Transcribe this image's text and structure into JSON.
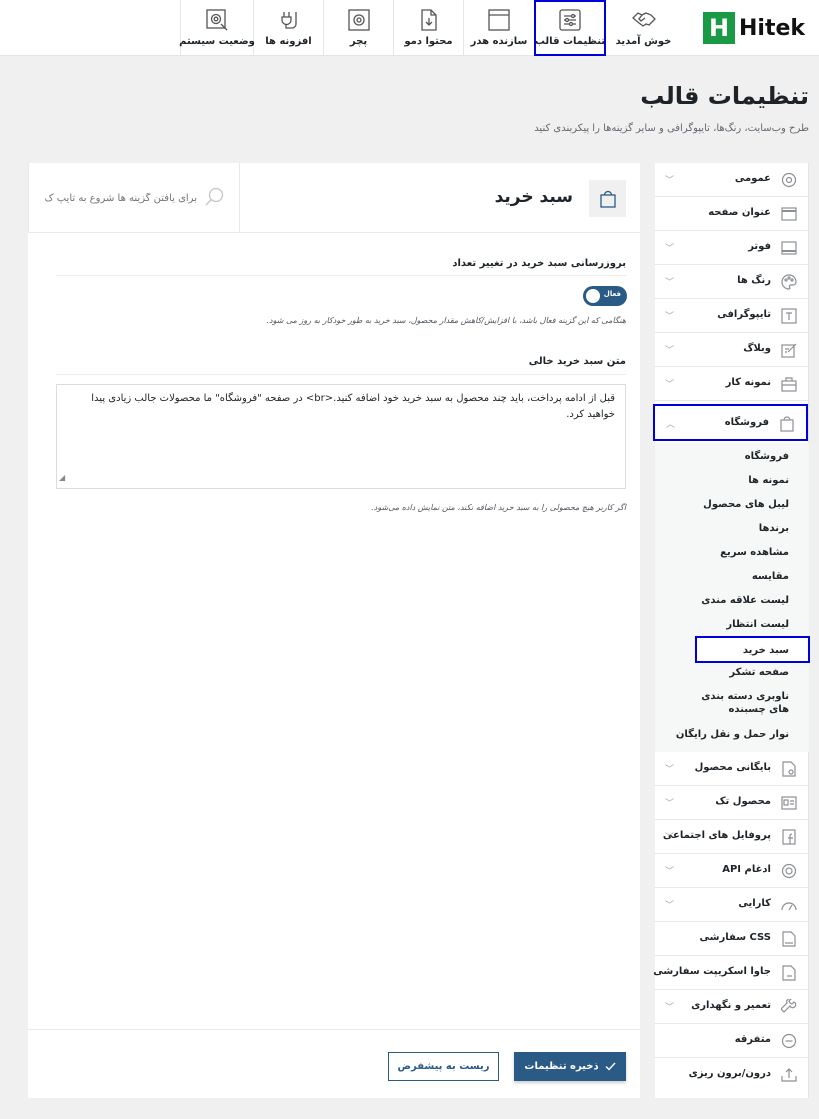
{
  "brand": {
    "logo_letter": "H",
    "logo_text": "Hitek",
    "accent": "#1a9a45"
  },
  "topnav": [
    {
      "label": "خوش آمدید",
      "icon": "handshake-icon"
    },
    {
      "label": "تنظیمات قالب",
      "icon": "sliders-icon",
      "active": true
    },
    {
      "label": "سازنده هدر",
      "icon": "window-icon"
    },
    {
      "label": "محتوا دمو",
      "icon": "document-download-icon"
    },
    {
      "label": "پچر",
      "icon": "gear-screen-icon"
    },
    {
      "label": "افزونه ها",
      "icon": "plug-icon"
    },
    {
      "label": "وضعیت سیستم",
      "icon": "gear-search-icon"
    }
  ],
  "page": {
    "title": "تنظیمات قالب",
    "subtitle": "طرح وب‌سایت، رنگ‌ها، تایپوگرافی و سایر گزینه‌ها را پیکربندی کنید"
  },
  "sidebar": {
    "items": [
      {
        "label": "عمومی",
        "icon": "gear-icon",
        "chevron": true
      },
      {
        "label": "عنوان صفحه",
        "icon": "title-bar-icon",
        "chevron": false
      },
      {
        "label": "فوتر",
        "icon": "footer-icon",
        "chevron": true
      },
      {
        "label": "رنگ ها",
        "icon": "palette-icon",
        "chevron": true
      },
      {
        "label": "تایپوگرافی",
        "icon": "text-icon",
        "chevron": true
      },
      {
        "label": "وبلاگ",
        "icon": "edit-icon",
        "chevron": true
      },
      {
        "label": "نمونه کار",
        "icon": "briefcase-icon",
        "chevron": true
      },
      {
        "label": "فروشگاه",
        "icon": "shopping-bag-icon",
        "chevron": true,
        "open": true
      }
    ],
    "shop_sub": [
      "فروشگاه",
      "نمونه ها",
      "لیبل های محصول",
      "برندها",
      "مشاهده سریع",
      "مقایسه",
      "لیست علاقه مندی",
      "لیست انتظار",
      "سبد خرید",
      "صفحه تشکر",
      "ناوبری دسته بندی های چسبنده",
      "نوار حمل و نقل رایگان"
    ],
    "active_sub": "سبد خرید",
    "items_after": [
      {
        "label": "بایگانی محصول",
        "icon": "archive-icon",
        "chevron": true
      },
      {
        "label": "محصول تک",
        "icon": "product-icon",
        "chevron": true
      },
      {
        "label": "پروفایل های اجتماعی",
        "icon": "facebook-icon",
        "chevron": true
      },
      {
        "label": "ادغام API",
        "icon": "api-icon",
        "chevron": true
      },
      {
        "label": "کارایی",
        "icon": "speedometer-icon",
        "chevron": true
      },
      {
        "label": "CSS سفارشی",
        "icon": "css-file-icon",
        "chevron": false
      },
      {
        "label": "جاوا اسکریپت سفارشی",
        "icon": "js-file-icon",
        "chevron": false
      },
      {
        "label": "تعمیر و نگهداری",
        "icon": "wrench-icon",
        "chevron": true
      },
      {
        "label": "متفرقه",
        "icon": "minus-circle-icon",
        "chevron": false
      },
      {
        "label": "درون/برون ریزی",
        "icon": "upload-icon",
        "chevron": false
      }
    ]
  },
  "section": {
    "title": "سبد خرید",
    "search_placeholder": "برای یافتن گزینه ها شروع به تایپ ک",
    "field1_label": "بروزرسانی سبد خرید در تغییر تعداد",
    "toggle_label": "فعال",
    "toggle_on": true,
    "field1_desc": "هنگامی که این گزینه فعال باشد، با افزایش/کاهش مقدار محصول، سبد خرید به طور خودکار به روز می شود.",
    "field2_label": "متن سبد خرید خالی",
    "field2_value": "قبل از ادامه پرداخت، باید چند محصول به سبد خرید خود اضافه کنید.<br> در صفحه \"فروشگاه\" ما محصولات جالب زیادی پیدا خواهید کرد.",
    "field2_desc": "اگر کاربر هیچ محصولی را به سبد خرید اضافه نکند، متن نمایش داده می‌شود."
  },
  "footer": {
    "save_label": "ذخیره تنظیمات",
    "reset_label": "ریست به پیشفرض"
  },
  "colors": {
    "primary": "#2a5b87",
    "highlight": "#0000dd"
  }
}
